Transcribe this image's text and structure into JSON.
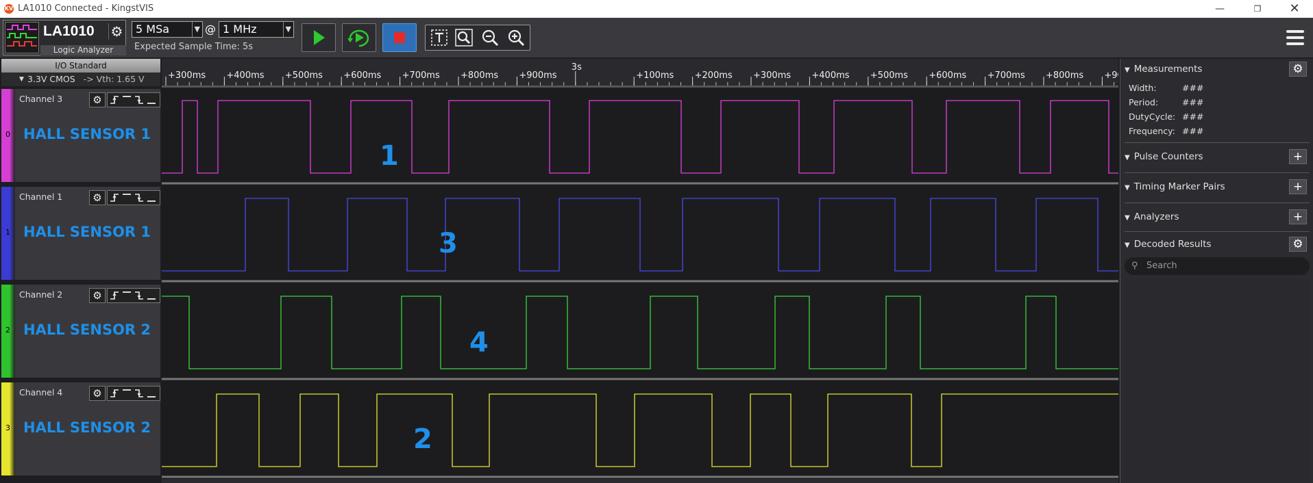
{
  "window": {
    "title": "LA1010 Connected - KingstVIS",
    "icon_text": "KV"
  },
  "toolbar": {
    "device_name": "LA1010",
    "device_subtitle": "Logic Analyzer",
    "sample_depth": "5 MSa",
    "at": "@",
    "sample_rate": "1 MHz",
    "expected_time": "Expected Sample Time: 5s"
  },
  "io": {
    "header": "I/O Standard",
    "value": "3.3V CMOS",
    "vth": "-> Vth: 1.65 V"
  },
  "channels": [
    {
      "index": "0",
      "name": "Channel 3",
      "label": "HALL SENSOR 1",
      "color": "#e040e0",
      "strip_color": "#d63fd6"
    },
    {
      "index": "1",
      "name": "Channel 1",
      "label": "HALL SENSOR 1",
      "color": "#4a4ae8",
      "strip_color": "#3b3bd6"
    },
    {
      "index": "2",
      "name": "Channel 2",
      "label": "HALL SENSOR 2",
      "color": "#3ad63a",
      "strip_color": "#2fc42f"
    },
    {
      "index": "3",
      "name": "Channel 4",
      "label": "HALL SENSOR 2",
      "color": "#e6e62e",
      "strip_color": "#e6e62e"
    }
  ],
  "ruler": {
    "labels": [
      "+300ms",
      "+400ms",
      "+500ms",
      "+600ms",
      "+700ms",
      "+800ms",
      "+900ms",
      "3s",
      "+100ms",
      "+200ms",
      "+300ms",
      "+400ms",
      "+500ms",
      "+600ms",
      "+700ms",
      "+800ms",
      "+90"
    ]
  },
  "annotations": [
    "1",
    "3",
    "4",
    "2"
  ],
  "right_panel": {
    "measurements_title": "Measurements",
    "measurements": [
      {
        "label": "Width:",
        "value": "###"
      },
      {
        "label": "Period:",
        "value": "###"
      },
      {
        "label": "DutyCycle:",
        "value": "###"
      },
      {
        "label": "Frequency:",
        "value": "###"
      }
    ],
    "pulse_counters": "Pulse Counters",
    "timing_marker_pairs": "Timing Marker Pairs",
    "analyzers": "Analyzers",
    "decoded_results": "Decoded Results",
    "search_placeholder": "Search"
  }
}
